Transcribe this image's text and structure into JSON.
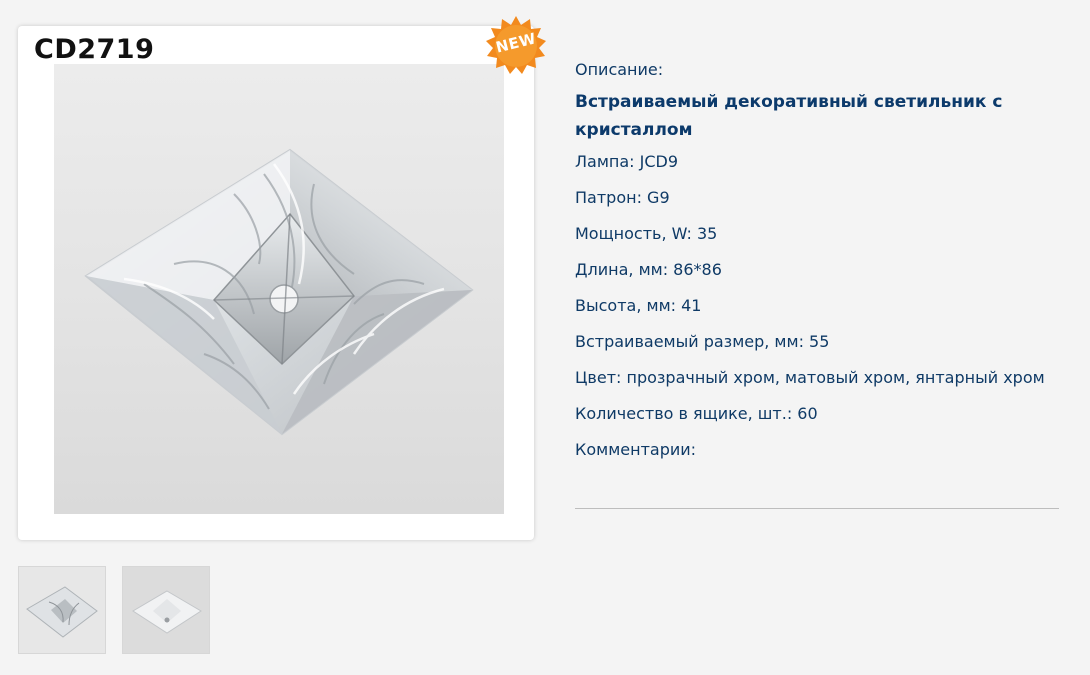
{
  "product": {
    "sku": "CD2719",
    "badge_label": "NEW",
    "images": [
      {
        "name": "thumbnail-clear-crystal"
      },
      {
        "name": "thumbnail-matte-crystal"
      }
    ]
  },
  "description": {
    "caption": "Описание:",
    "title": "Встраиваемый декоративный светильник с кристаллом",
    "specs": [
      "Лампа: JCD9",
      "Патрон: G9",
      "Мощность, W: 35",
      "Длина, мм: 86*86",
      "Высота, мм: 41",
      "Встраиваемый размер, мм: 55",
      "Цвет: прозрачный хром, матовый хром, янтарный хром",
      "Количество в ящике, шт.: 60",
      "Комментарии:"
    ]
  },
  "colors": {
    "text_blue": "#0f3a66",
    "badge_orange": "#f28a1e",
    "background": "#f4f4f4"
  }
}
